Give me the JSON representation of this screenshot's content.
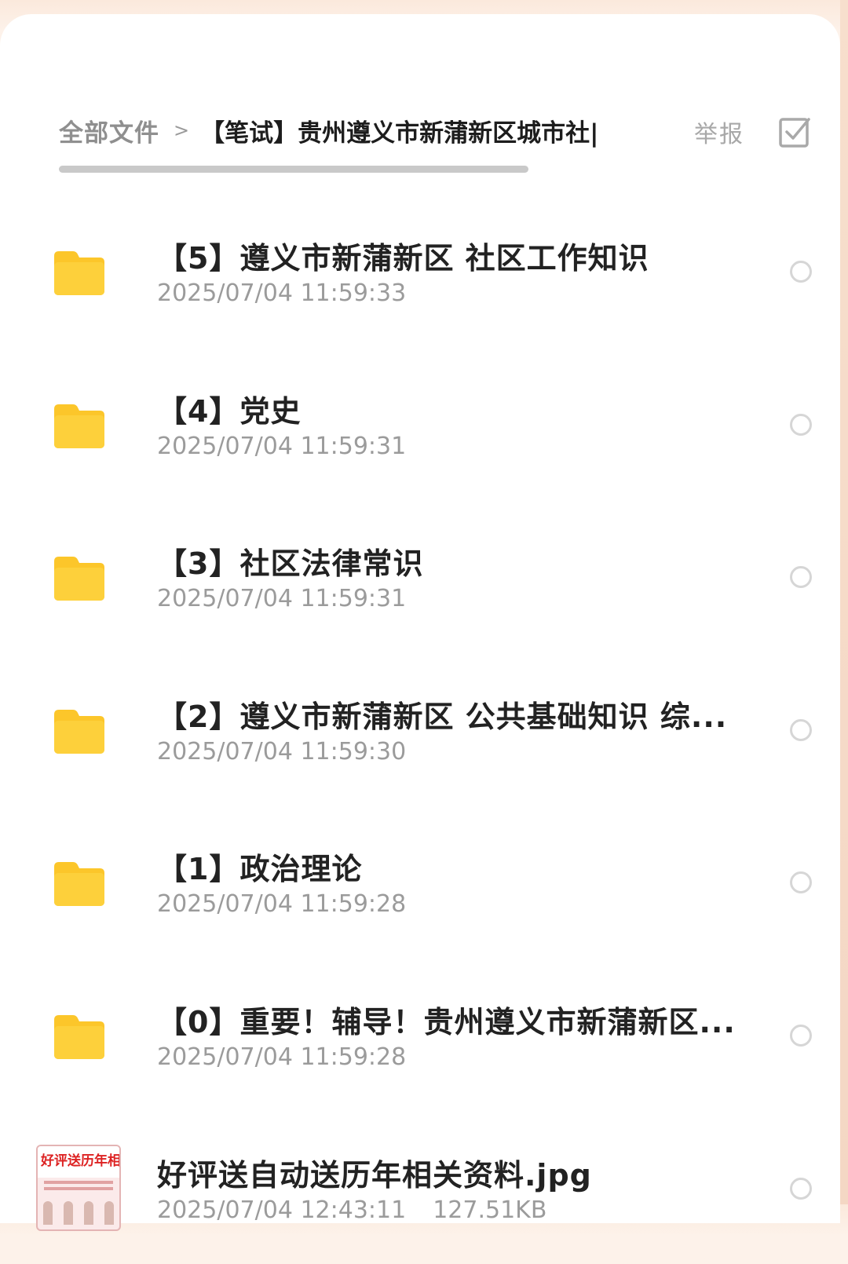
{
  "breadcrumb": {
    "root": "全部文件",
    "separator": ">",
    "current": "【笔试】贵州遵义市新蒲新区城市社|"
  },
  "header": {
    "report_label": "举报",
    "select_icon": "checkbox-select-icon"
  },
  "files": [
    {
      "type": "folder",
      "name": "【5】遵义市新蒲新区 社区工作知识",
      "time": "2025/07/04 11:59:33",
      "size": ""
    },
    {
      "type": "folder",
      "name": "【4】党史",
      "time": "2025/07/04 11:59:31",
      "size": ""
    },
    {
      "type": "folder",
      "name": "【3】社区法律常识",
      "time": "2025/07/04 11:59:31",
      "size": ""
    },
    {
      "type": "folder",
      "name": "【2】遵义市新蒲新区 公共基础知识 综...",
      "time": "2025/07/04 11:59:30",
      "size": ""
    },
    {
      "type": "folder",
      "name": "【1】政治理论",
      "time": "2025/07/04 11:59:28",
      "size": ""
    },
    {
      "type": "folder",
      "name": "【0】重要！辅导！贵州遵义市新蒲新区...",
      "time": "2025/07/04 11:59:28",
      "size": ""
    },
    {
      "type": "image",
      "name": "好评送自动送历年相关资料.jpg",
      "time": "2025/07/04 12:43:11",
      "size": "127.51KB"
    }
  ],
  "thumbnail": {
    "text": "好评送历年相关"
  },
  "colors": {
    "folder": "#fdd03b",
    "folder_tab": "#fcc62a",
    "radio_border": "#d6d6d6",
    "meta_text": "#9b9b9b"
  }
}
